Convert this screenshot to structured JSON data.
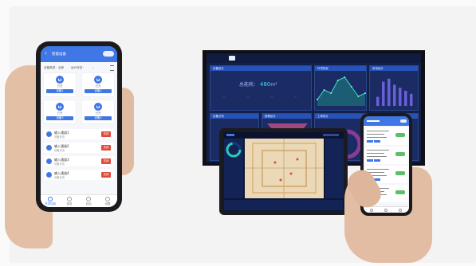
{
  "scene": "multi-device-showcase",
  "left_phone": {
    "nav_title": "智能设备",
    "filter_labels": [
      "设备类型：全部",
      "运行状态：",
      "..."
    ],
    "devices": [
      {
        "status": "已关",
        "name": "设备1"
      },
      {
        "status": "已关",
        "name": "设备2"
      },
      {
        "status": "已开",
        "name": "设备3"
      },
      {
        "status": "已开",
        "name": "设备4"
      }
    ],
    "list": [
      {
        "title": "输入通道1",
        "sub": "设备状态",
        "action": "关闭"
      },
      {
        "title": "输入通道2",
        "sub": "设备状态",
        "action": "关闭"
      },
      {
        "title": "输入通道3",
        "sub": "设备状态",
        "action": "关闭"
      },
      {
        "title": "输入通道4",
        "sub": "设备状态",
        "action": "关闭"
      }
    ],
    "tabs": [
      "开关控制",
      "信息",
      "自动",
      "设置"
    ]
  },
  "monitor": {
    "tabs": [
      "",
      "",
      ""
    ],
    "panel_titles": [
      "设备统计",
      "环境指标",
      "用电统计",
      "设备分布",
      "报警统计",
      "工单统计"
    ],
    "big_value_label": "总能耗：",
    "big_value": "480",
    "big_value_unit": "m³",
    "line_series": [
      2,
      5,
      4,
      8,
      9,
      6,
      3,
      4
    ],
    "bar_series": [
      3,
      8,
      9,
      7,
      6,
      5,
      4
    ]
  },
  "tablet": {},
  "right_phone": {},
  "colors": {
    "primary": "#3f77e6",
    "danger": "#e04a3c",
    "success": "#5bbf6a",
    "dashboard_bg": "#13204a"
  }
}
